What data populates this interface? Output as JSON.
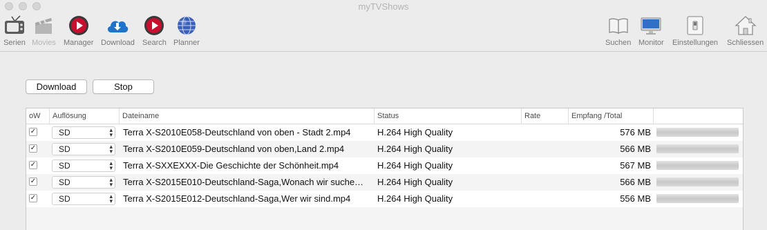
{
  "window": {
    "title": "myTVShows"
  },
  "toolbar_left": [
    {
      "label": "Serien",
      "icon": "tv-icon",
      "enabled": true
    },
    {
      "label": "Movies",
      "icon": "clapperboard-icon",
      "enabled": false
    },
    {
      "label": "Manager",
      "icon": "play-circle-icon",
      "enabled": true
    },
    {
      "label": "Download",
      "icon": "cloud-download-icon",
      "enabled": true
    },
    {
      "label": "Search",
      "icon": "play-circle-icon",
      "enabled": true
    },
    {
      "label": "Planner",
      "icon": "globe-icon",
      "enabled": true
    }
  ],
  "toolbar_right": [
    {
      "label": "Suchen",
      "icon": "book-icon"
    },
    {
      "label": "Monitor",
      "icon": "monitor-icon"
    },
    {
      "label": "Einstellungen",
      "icon": "switch-icon"
    },
    {
      "label": "Schliessen",
      "icon": "home-icon"
    }
  ],
  "buttons": {
    "download": "Download",
    "stop": "Stop"
  },
  "table": {
    "columns": [
      "oW",
      "Auflösung",
      "Dateiname",
      "Status",
      "Rate",
      "Empfang /Total"
    ],
    "rows": [
      {
        "checked": true,
        "resolution": "SD",
        "filename": "Terra X-S2010E058-Deutschland von oben - Stadt 2.mp4",
        "status": "H.264 High Quality",
        "rate": "",
        "size": "576 MB"
      },
      {
        "checked": true,
        "resolution": "SD",
        "filename": "Terra X-S2010E059-Deutschland von oben,Land 2.mp4",
        "status": "H.264 High Quality",
        "rate": "",
        "size": "566 MB"
      },
      {
        "checked": true,
        "resolution": "SD",
        "filename": "Terra X-SXXEXXX-Die Geschichte der Schönheit.mp4",
        "status": "H.264 High Quality",
        "rate": "",
        "size": "567 MB"
      },
      {
        "checked": true,
        "resolution": "SD",
        "filename": "Terra X-S2015E010-Deutschland-Saga,Wonach wir suche…",
        "status": "H.264 High Quality",
        "rate": "",
        "size": "566 MB"
      },
      {
        "checked": true,
        "resolution": "SD",
        "filename": "Terra X-S2015E012-Deutschland-Saga,Wer wir sind.mp4",
        "status": "H.264 High Quality",
        "rate": "",
        "size": "556 MB"
      }
    ]
  },
  "colors": {
    "play_red": "#c8102e",
    "cloud_blue": "#1f73c9",
    "globe_blue": "#3a5fb8"
  }
}
